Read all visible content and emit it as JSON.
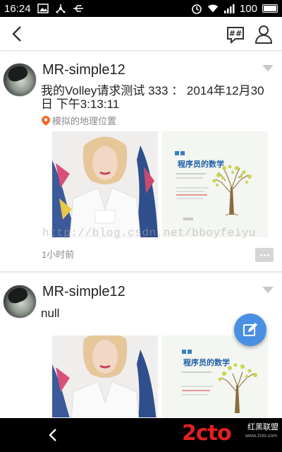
{
  "status_bar": {
    "time": "16:24",
    "battery": "100",
    "icons": [
      "image-icon",
      "usb-icon",
      "usb-icon",
      "alarm-icon",
      "wifi-icon",
      "signal-icon",
      "battery-icon"
    ]
  },
  "header": {
    "back_icon": "back-icon",
    "hash_icon": "hashtag-chat-icon",
    "user_icon": "user-icon"
  },
  "posts": [
    {
      "username": "MR-simple12",
      "text": "我的Volley请求测试   333 ： 2014年12月30日  下午3:13:11",
      "location": "模拟的地理位置",
      "time": "1小时前",
      "book_title": "程序员的数学"
    },
    {
      "username": "MR-simple12",
      "text": "null",
      "book_title": "程序员的数学"
    }
  ],
  "watermark": "http://blog.csdn.net/bboyfeiyu",
  "nav_bar": {
    "logo_main": "2cto",
    "logo_sub": "红黑联盟",
    "logo_url": "www.2cto.com"
  },
  "colors": {
    "accent": "#4a90e2",
    "location_pin": "#f06a2a",
    "logo_red": "#e02020"
  }
}
